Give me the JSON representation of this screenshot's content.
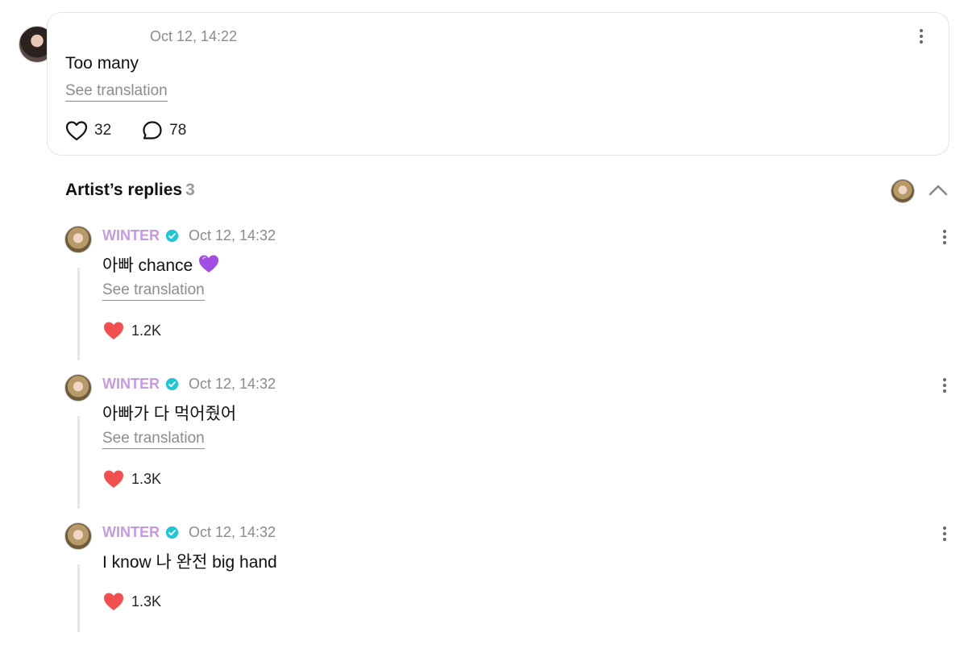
{
  "post": {
    "timestamp": "Oct 12, 14:22",
    "text": "Too many",
    "see_translation": "See translation",
    "likes": "32",
    "comments": "78"
  },
  "artist_replies": {
    "title": "Artist’s replies",
    "count": "3"
  },
  "replies": [
    {
      "author": "WINTER",
      "timestamp": "Oct 12, 14:32",
      "text": "아빠 chance",
      "emoji": "purple-heart",
      "see_translation": "See translation",
      "likes": "1.2K"
    },
    {
      "author": "WINTER",
      "timestamp": "Oct 12, 14:32",
      "text": "아빠가 다 먹어줬어",
      "see_translation": "See translation",
      "likes": "1.3K"
    },
    {
      "author": "WINTER",
      "timestamp": "Oct 12, 14:32",
      "text": "I know 나 완전 big hand",
      "likes": "1.3K"
    }
  ],
  "colors": {
    "author_name": "#c49ae0",
    "verified_badge": "#1fc6d6",
    "liked_heart": "#f0504f",
    "muted_text": "#8b8b8b"
  }
}
